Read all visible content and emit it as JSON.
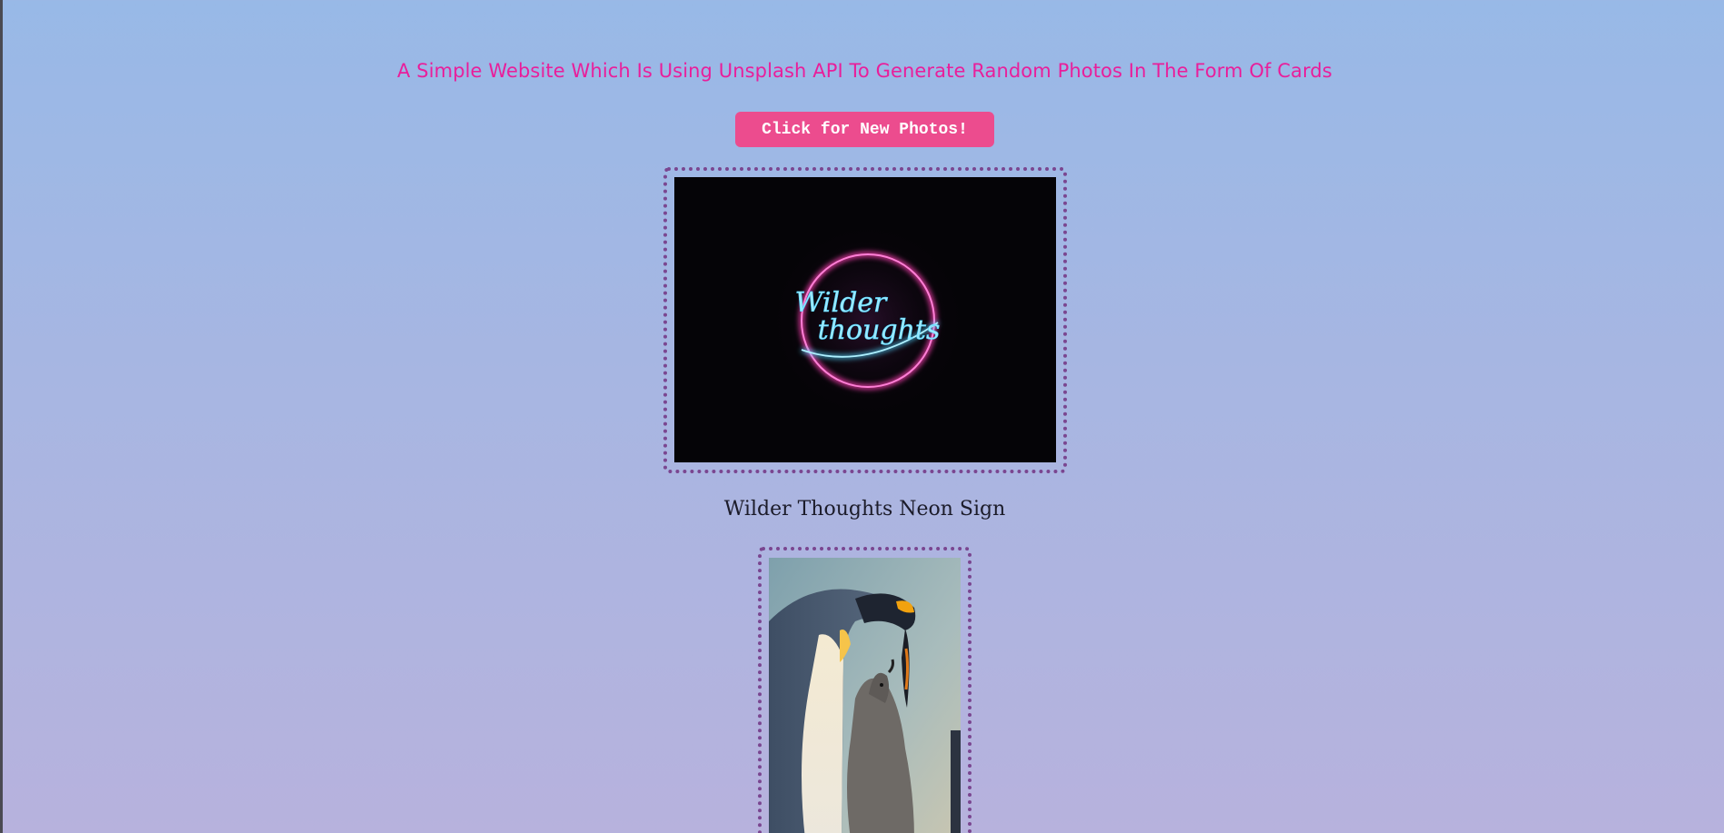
{
  "header": {
    "headline": "A Simple Website Which Is Using Unsplash API To Generate Random Photos In The Form Of Cards"
  },
  "actions": {
    "new_photos_label": "Click for New Photos!"
  },
  "cards": [
    {
      "caption": "Wilder Thoughts Neon Sign",
      "image_text": [
        "Wilder",
        "thoughts"
      ]
    },
    {
      "caption": ""
    }
  ],
  "colors": {
    "headline": "#e91e9b",
    "button": "#ec4c8e",
    "frame": "#7a4690"
  }
}
